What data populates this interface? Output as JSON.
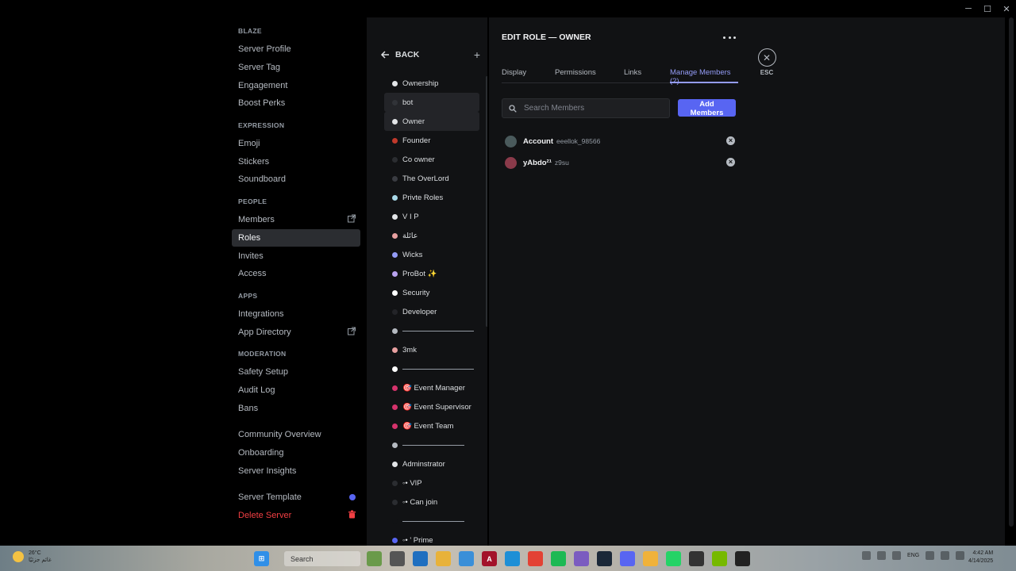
{
  "window": {
    "minimize": "─",
    "maximize": "☐",
    "close": "✕"
  },
  "sidebar": {
    "sections": [
      {
        "title": "BLAZE",
        "items": [
          {
            "label": "Server Profile"
          },
          {
            "label": "Server Tag"
          },
          {
            "label": "Engagement"
          },
          {
            "label": "Boost Perks"
          }
        ]
      },
      {
        "title": "EXPRESSION",
        "items": [
          {
            "label": "Emoji"
          },
          {
            "label": "Stickers"
          },
          {
            "label": "Soundboard"
          }
        ]
      },
      {
        "title": "PEOPLE",
        "items": [
          {
            "label": "Members"
          },
          {
            "label": "Roles"
          },
          {
            "label": "Invites"
          },
          {
            "label": "Access"
          }
        ]
      },
      {
        "title": "APPS",
        "items": [
          {
            "label": "Integrations"
          },
          {
            "label": "App Directory"
          }
        ]
      },
      {
        "title": "MODERATION",
        "items": [
          {
            "label": "Safety Setup"
          },
          {
            "label": "Audit Log"
          },
          {
            "label": "Bans"
          }
        ]
      },
      {
        "title": "",
        "items": [
          {
            "label": "Community Overview"
          },
          {
            "label": "Onboarding"
          },
          {
            "label": "Server Insights"
          }
        ]
      },
      {
        "title": "",
        "items": [
          {
            "label": "Server Template"
          },
          {
            "label": "Delete Server"
          }
        ]
      }
    ]
  },
  "roles_panel": {
    "back_label": "BACK",
    "add_icon": "+",
    "roles": [
      {
        "name": "Ownership",
        "color": "#e3e5e8"
      },
      {
        "name": "bot",
        "color": "#313338"
      },
      {
        "name": "Owner",
        "color": "#e3e5e8"
      },
      {
        "name": "Founder",
        "color": "#c0392b"
      },
      {
        "name": "Co owner",
        "color": "#2b2d31"
      },
      {
        "name": "The OverLord",
        "color": "#3a3c42"
      },
      {
        "name": "Privte Roles",
        "color": "#a8d8e8"
      },
      {
        "name": "V I P",
        "color": "#e3e5e8"
      },
      {
        "name": "عائلة",
        "color": "#e8a0a0"
      },
      {
        "name": "Wicks",
        "color": "#949cf7"
      },
      {
        "name": "ProBot ✨",
        "color": "#b9a3f0"
      },
      {
        "name": "Security",
        "color": "#ffffff"
      },
      {
        "name": "Developer",
        "color": "#232428"
      },
      {
        "name": "",
        "color": "#b5bac1"
      },
      {
        "name": "3mk",
        "color": "#e8a0a0"
      },
      {
        "name": "",
        "color": "#ffffff"
      },
      {
        "name": "🎯 Event Manager",
        "color": "#d6336c"
      },
      {
        "name": "🎯 Event Supervisor",
        "color": "#d6336c"
      },
      {
        "name": "🎯 Event Team",
        "color": "#d6336c"
      },
      {
        "name": "",
        "color": "#b5bac1"
      },
      {
        "name": "Adminstrator",
        "color": "#e3e5e8"
      },
      {
        "name": "◦• VIP",
        "color": "#2b2d31"
      },
      {
        "name": "◦• Can join",
        "color": "#2b2d31"
      },
      {
        "name": "",
        "color": "#111214"
      },
      {
        "name": "◦• ' Prime",
        "color": "#5865f2"
      }
    ]
  },
  "edit": {
    "title": "EDIT ROLE — OWNER",
    "tabs": [
      {
        "label": "Display"
      },
      {
        "label": "Permissions"
      },
      {
        "label": "Links"
      },
      {
        "label": "Manage Members (2)"
      }
    ],
    "search_placeholder": "Search Members",
    "add_button": "Add Members",
    "members": [
      {
        "name": "Account",
        "username": "eeellok_98566",
        "avatar_color": "#4a5a5c"
      },
      {
        "name": "yAbdo²¹",
        "username": "z9su",
        "avatar_color": "#8a3a4a"
      }
    ],
    "esc_label": "ESC"
  },
  "taskbar": {
    "weather_temp": "26°C",
    "weather_desc": "غائم جزئيًا",
    "search_label": "Search",
    "lang": "ENG",
    "time": "4:42 AM",
    "date": "4/14/2025"
  },
  "colors": {
    "accent": "#5865f2",
    "tab_active": "#949cf7",
    "danger": "#f23f43",
    "panel": "#111214"
  }
}
